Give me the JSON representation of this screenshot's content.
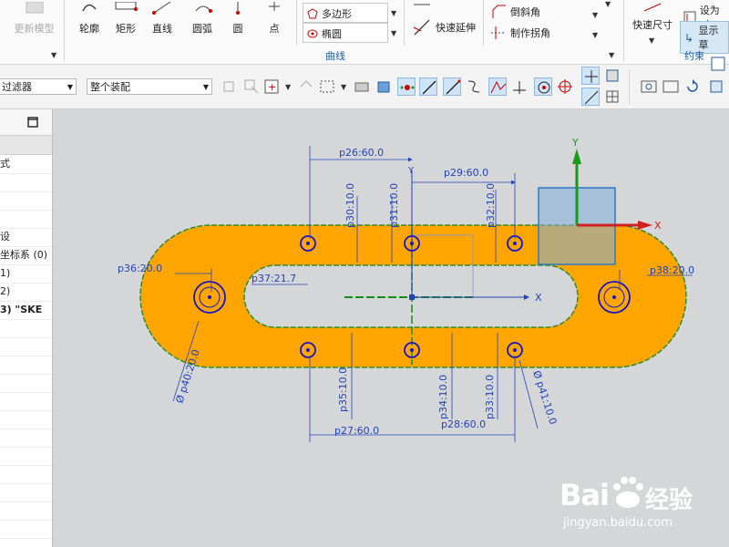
{
  "ribbon": {
    "update_model": "更新模型",
    "profile": "轮廓",
    "rectangle": "矩形",
    "line": "直线",
    "arc": "圆弧",
    "circle": "圆",
    "point": "点",
    "polygon": "多边形",
    "ellipse": "椭圆",
    "quick_extend": "快速延伸",
    "chamfer": "倒斜角",
    "make_corner": "制作拐角",
    "curve_group": "曲线",
    "quick_dimension": "快速尺寸",
    "set_as": "设为对",
    "show": "显示草",
    "constraint_group": "约束"
  },
  "toolbar": {
    "filter": "过滤器",
    "assembly": "整个装配"
  },
  "nav": {
    "rows": [
      "式",
      "",
      "",
      "",
      "设",
      "坐标系 (0)",
      "1)",
      "2)",
      "3) \"SKE",
      "",
      "",
      "",
      "",
      "",
      "",
      "",
      "",
      "",
      "",
      "",
      ""
    ]
  },
  "sketch": {
    "dims": {
      "p26": "p26:60.0",
      "p29": "p29:60.0",
      "p30": "p30:10.0",
      "p31": "p31:10.0",
      "p32": "p32:10.0",
      "p36": "p36:20.0",
      "p37": "p37:21.7",
      "p38": "p38:20.0",
      "p40": "Ø p40:20.0",
      "p35": "p35:10.0",
      "p34": "p34:10.0",
      "p33": "p33:10.0",
      "p41": "Ø p41:10.0",
      "p27": "p27:60.0",
      "p28": "p28:60.0"
    },
    "axes": {
      "x": "X",
      "y": "Y"
    }
  },
  "watermark": {
    "brand": "Bai",
    "cn": "经验",
    "url": "jingyan.baidu.com"
  },
  "colors": {
    "fill": "#ffa500",
    "dim": "#2244bb",
    "center": "#1a8a1a",
    "profile_green": "#2e8b2e",
    "accent": "#1a5ea8"
  }
}
